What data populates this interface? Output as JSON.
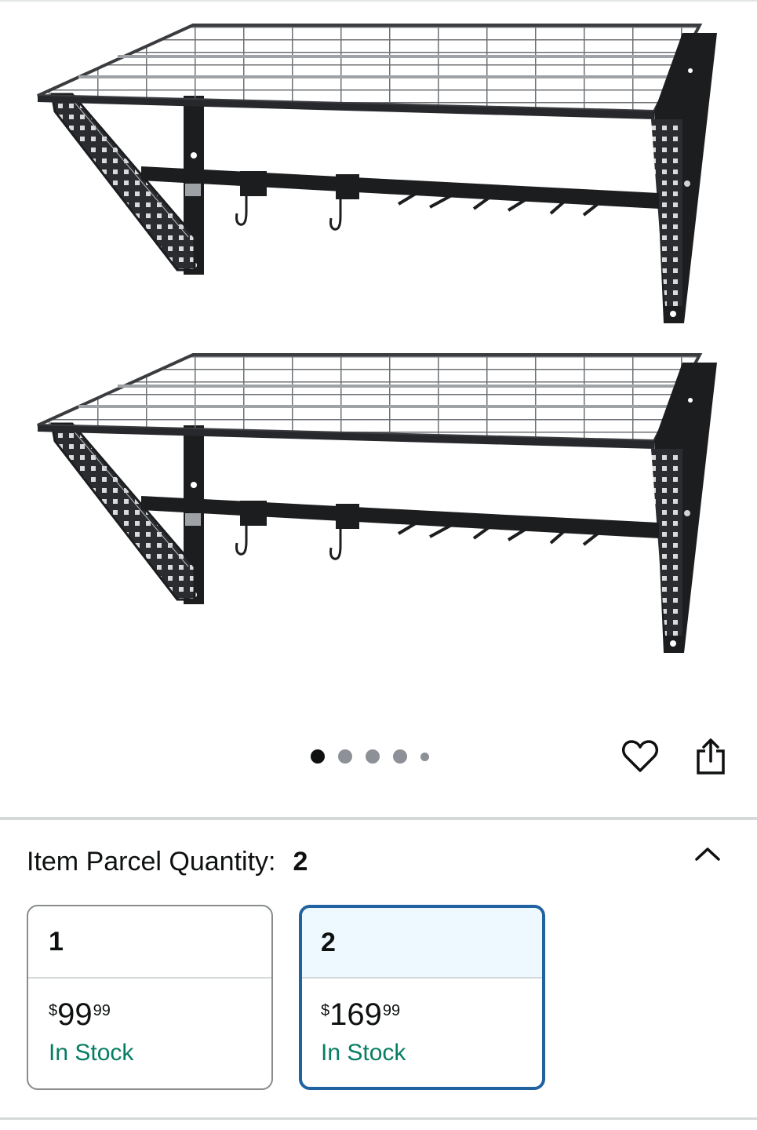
{
  "gallery": {
    "image_icon": "wall-shelf-product-photo",
    "dot_count": 5,
    "active_index": 0
  },
  "actions": {
    "favorite_icon": "heart-icon",
    "share_icon": "share-icon"
  },
  "variation": {
    "label": "Item Parcel Quantity:",
    "selected_value": "2",
    "collapse_icon": "chevron-up-icon",
    "options": [
      {
        "title": "1",
        "price_symbol": "$",
        "price_whole": "99",
        "price_fraction": "99",
        "availability": "In Stock",
        "selected": false
      },
      {
        "title": "2",
        "price_symbol": "$",
        "price_whole": "169",
        "price_fraction": "99",
        "availability": "In Stock",
        "selected": true
      }
    ]
  },
  "colors": {
    "selected_border": "#2162a1",
    "selected_header_bg": "#edf8ff",
    "in_stock": "#067d62"
  }
}
